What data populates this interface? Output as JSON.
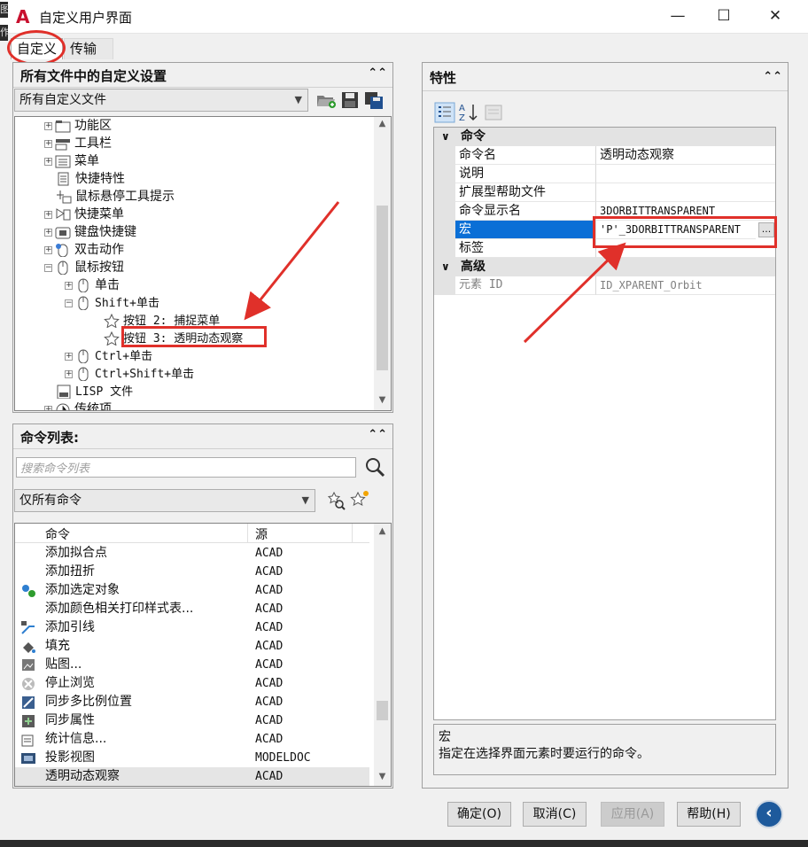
{
  "window": {
    "title": "自定义用户界面",
    "minimize": "—",
    "maximize": "☐",
    "close": "✕",
    "edge_fragments": [
      "图",
      "作"
    ]
  },
  "tabs": [
    {
      "label": "自定义",
      "active": true
    },
    {
      "label": "传输",
      "active": false
    }
  ],
  "left_top": {
    "title": "所有文件中的自定义设置",
    "file_combo": "所有自定义文件",
    "tree": [
      {
        "label": "功能区",
        "icon": "ribbon-icon"
      },
      {
        "label": "工具栏",
        "icon": "toolbar-icon"
      },
      {
        "label": "菜单",
        "icon": "menu-icon"
      },
      {
        "label": "快捷特性",
        "icon": "quick-properties-icon"
      },
      {
        "label": "鼠标悬停工具提示",
        "icon": "rollover-tooltip-icon"
      },
      {
        "label": "快捷菜单",
        "icon": "shortcut-menu-icon"
      },
      {
        "label": "键盘快捷键",
        "icon": "keyboard-shortcut-icon"
      },
      {
        "label": "双击动作",
        "icon": "double-click-icon"
      },
      {
        "label": "鼠标按钮",
        "icon": "mouse-buttons-icon"
      },
      {
        "label": "单击",
        "icon": "mouse-icon"
      },
      {
        "label": "Shift+单击",
        "icon": "mouse-icon"
      },
      {
        "label": "按钮 2: 捕捉菜单",
        "icon": "star-icon"
      },
      {
        "label": "按钮 3: 透明动态观察",
        "icon": "star-icon"
      },
      {
        "label": "Ctrl+单击",
        "icon": "mouse-icon"
      },
      {
        "label": "Ctrl+Shift+单击",
        "icon": "mouse-icon"
      },
      {
        "label": "LISP 文件",
        "icon": "lisp-icon"
      },
      {
        "label": "传统项",
        "icon": "legacy-icon"
      }
    ]
  },
  "left_bottom": {
    "title": "命令列表:",
    "search_placeholder": "搜索命令列表",
    "filter_combo": "仅所有命令",
    "columns": [
      "命令",
      "源"
    ],
    "rows": [
      {
        "name": "添加拟合点",
        "source": "ACAD",
        "icon": ""
      },
      {
        "name": "添加扭折",
        "source": "ACAD",
        "icon": ""
      },
      {
        "name": "添加选定对象",
        "source": "ACAD",
        "icon": "add-selected-icon"
      },
      {
        "name": "添加颜色相关打印样式表...",
        "source": "ACAD",
        "icon": ""
      },
      {
        "name": "添加引线",
        "source": "ACAD",
        "icon": "add-leader-icon"
      },
      {
        "name": "填充",
        "source": "ACAD",
        "icon": "fill-icon"
      },
      {
        "name": "贴图...",
        "source": "ACAD",
        "icon": "map-icon"
      },
      {
        "name": "停止浏览",
        "source": "ACAD",
        "icon": "stop-browse-icon"
      },
      {
        "name": "同步多比例位置",
        "source": "ACAD",
        "icon": "sync-scale-icon"
      },
      {
        "name": "同步属性",
        "source": "ACAD",
        "icon": "sync-attributes-icon"
      },
      {
        "name": "统计信息...",
        "source": "ACAD",
        "icon": "statistics-icon"
      },
      {
        "name": "投影视图",
        "source": "MODELDOC",
        "icon": "projected-view-icon"
      },
      {
        "name": "透明动态观察",
        "source": "ACAD",
        "icon": ""
      }
    ]
  },
  "properties": {
    "title": "特性",
    "categories": [
      {
        "label": "命令",
        "rows": [
          {
            "name": "命令名",
            "value": "透明动态观察"
          },
          {
            "name": "说明",
            "value": ""
          },
          {
            "name": "扩展型帮助文件",
            "value": ""
          },
          {
            "name": "命令显示名",
            "value": "3DORBITTRANSPARENT"
          },
          {
            "name": "宏",
            "value": "'P'_3DORBITTRANSPARENT"
          },
          {
            "name": "标签",
            "value": ""
          }
        ]
      },
      {
        "label": "高级",
        "rows": [
          {
            "name": "元素 ID",
            "value": "ID_XPARENT_Orbit"
          }
        ]
      }
    ],
    "ellipsis": "...",
    "description": {
      "title": "宏",
      "text": "指定在选择界面元素时要运行的命令。"
    }
  },
  "buttons": {
    "ok": "确定(O)",
    "cancel": "取消(C)",
    "apply": "应用(A)",
    "help": "帮助(H)"
  },
  "colors": {
    "selection": "#0a6fd6",
    "annotation_red": "#e0302a"
  }
}
